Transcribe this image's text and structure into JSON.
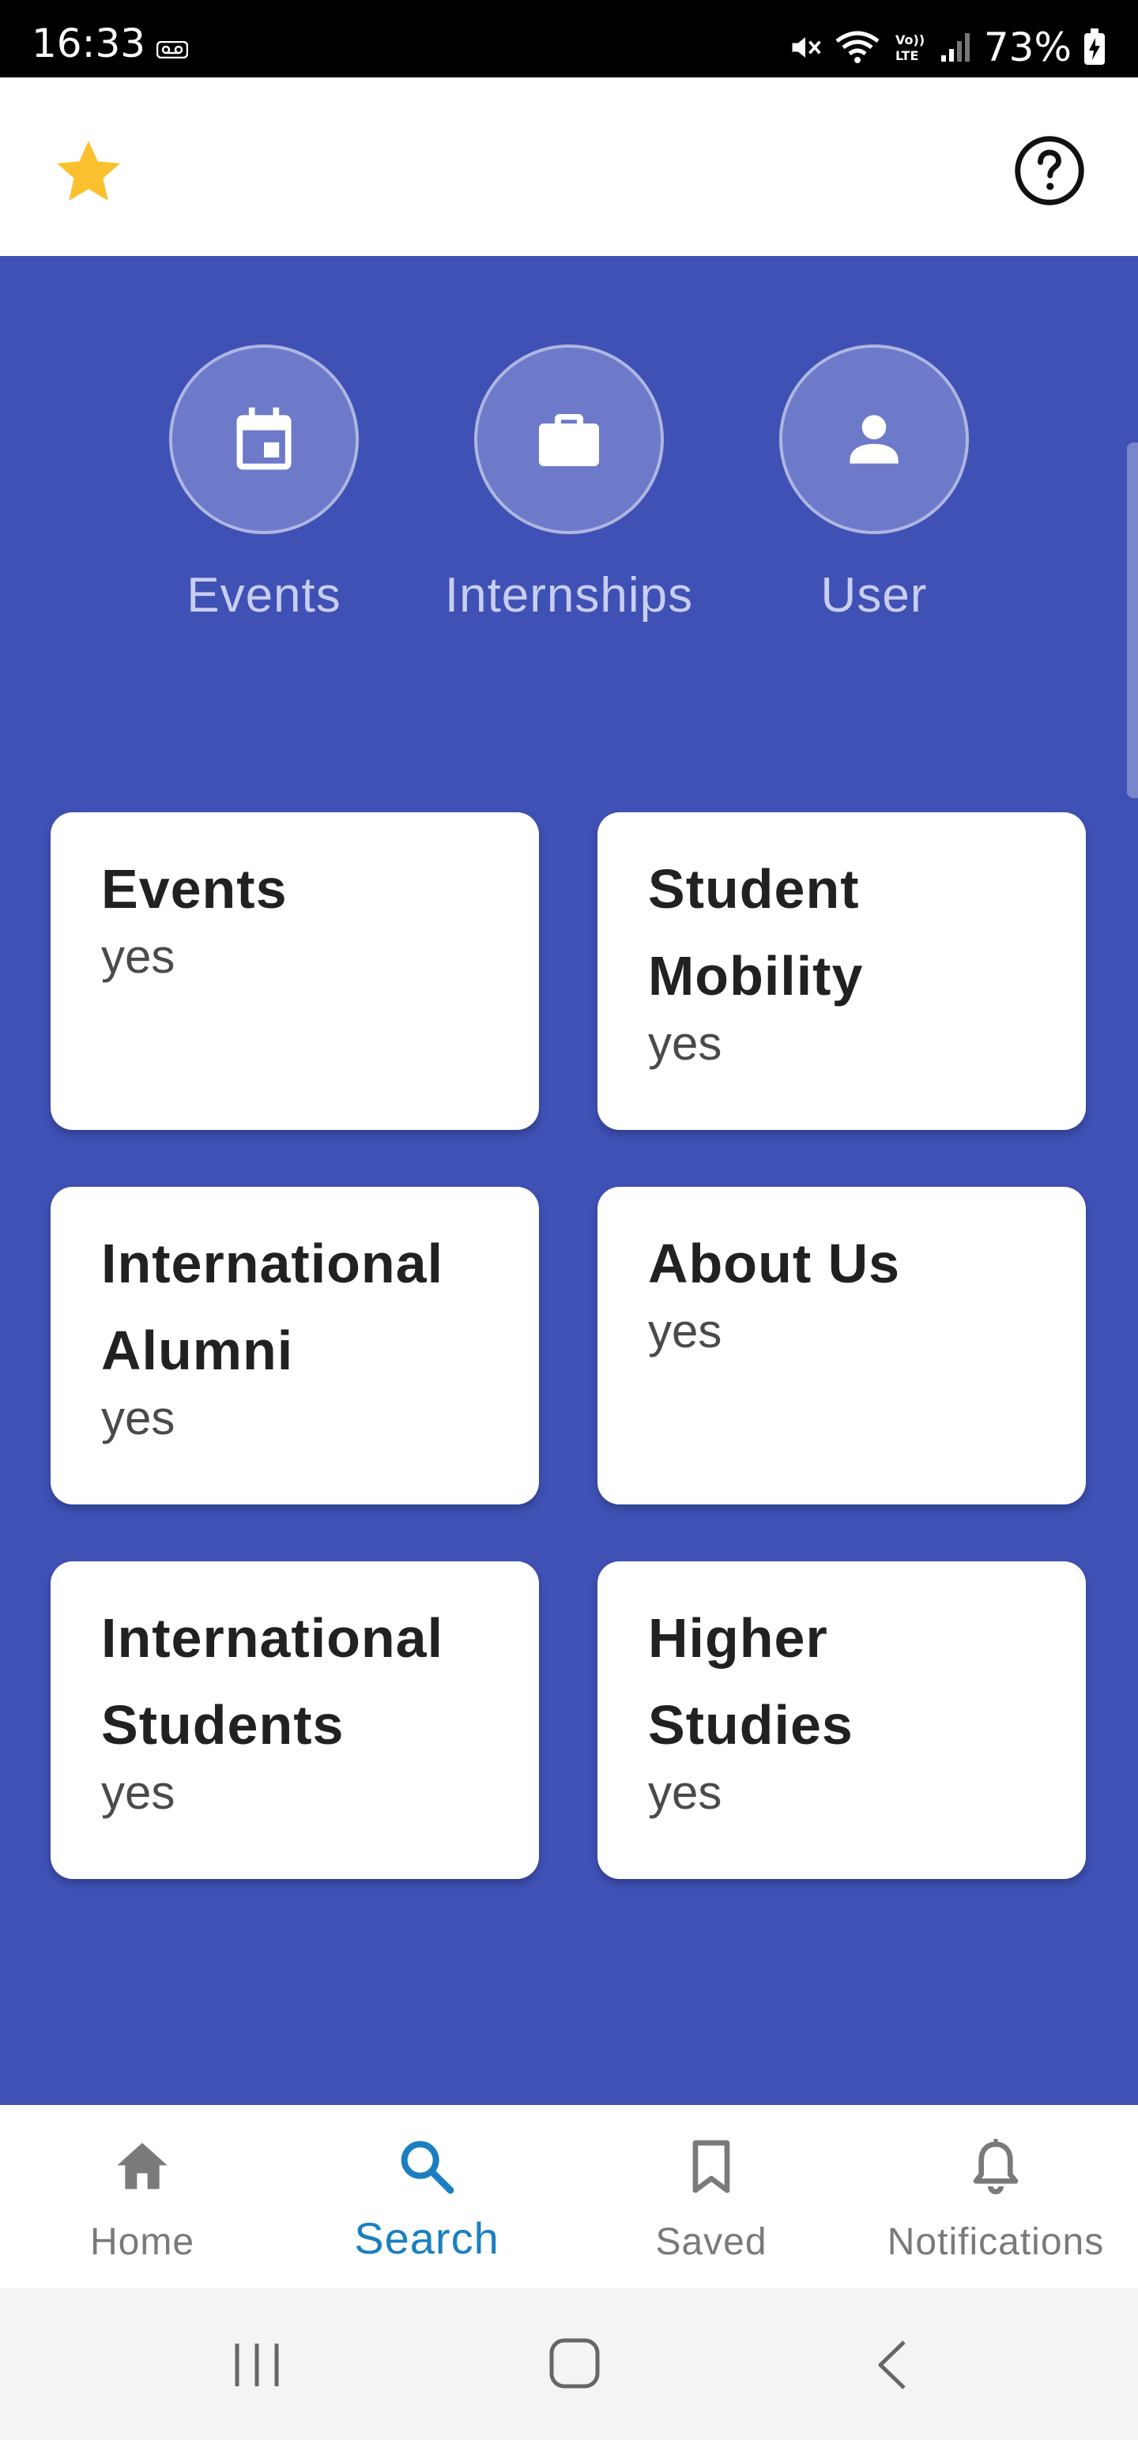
{
  "status_bar": {
    "time": "16:33",
    "battery": "73%"
  },
  "app_bar": {
    "favorite_icon": "star-icon",
    "help_icon": "help-circle-icon"
  },
  "quick_actions": [
    {
      "label": "Events",
      "icon": "calendar-icon"
    },
    {
      "label": "Internships",
      "icon": "briefcase-icon"
    },
    {
      "label": "User",
      "icon": "person-icon"
    }
  ],
  "cards": [
    {
      "title": "Events",
      "subtitle": "yes"
    },
    {
      "title": "Student Mobility",
      "subtitle": "yes"
    },
    {
      "title": "International Alumni",
      "subtitle": "yes"
    },
    {
      "title": "About Us",
      "subtitle": "yes"
    },
    {
      "title": "International Students",
      "subtitle": "yes"
    },
    {
      "title": "Higher Studies",
      "subtitle": "yes"
    }
  ],
  "bottom_nav": [
    {
      "label": "Home",
      "icon": "home-icon",
      "active": false
    },
    {
      "label": "Search",
      "icon": "search-icon",
      "active": true
    },
    {
      "label": "Saved",
      "icon": "bookmark-icon",
      "active": false
    },
    {
      "label": "Notifications",
      "icon": "bell-icon",
      "active": false
    }
  ],
  "colors": {
    "primary": "#3f51b5",
    "accent_active": "#1a7fc1",
    "star": "#fbc02d"
  }
}
